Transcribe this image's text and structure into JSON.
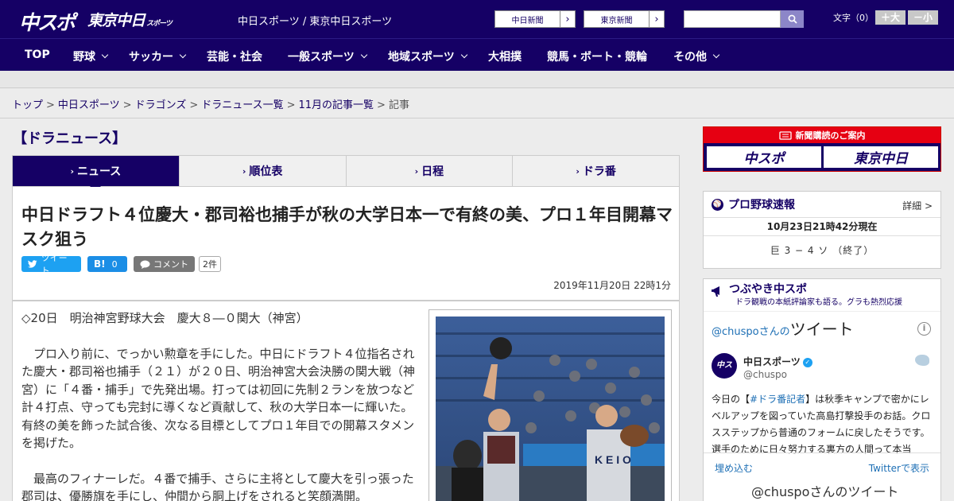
{
  "header": {
    "logo_main": "中スポ",
    "logo_tokyo": "東京中日",
    "logo_tokyo_sub": "スポーツ",
    "site_name": "中日スポーツ / 東京中日スポーツ",
    "ext_links": [
      "中日新聞",
      "東京新聞"
    ],
    "search_placeholder": "",
    "font_size_label": "文字（0）",
    "font_bigger": "＋大",
    "font_smaller": "－小"
  },
  "nav": {
    "items": [
      {
        "label": "TOP",
        "has_menu": false
      },
      {
        "label": "野球",
        "has_menu": true
      },
      {
        "label": "サッカー",
        "has_menu": true
      },
      {
        "label": "芸能・社会",
        "has_menu": false
      },
      {
        "label": "一般スポーツ",
        "has_menu": true
      },
      {
        "label": "地域スポーツ",
        "has_menu": true
      },
      {
        "label": "大相撲",
        "has_menu": false
      },
      {
        "label": "競馬・ボート・競輪",
        "has_menu": false
      },
      {
        "label": "その他",
        "has_menu": true
      }
    ]
  },
  "breadcrumb": {
    "items": [
      "トップ",
      "中日スポーツ",
      "ドラゴンズ",
      "ドラニュース一覧",
      "11月の記事一覧"
    ],
    "current": "記事"
  },
  "section_title": "【ドラニュース】",
  "tabs": [
    {
      "label": "ニュース",
      "active": true
    },
    {
      "label": "順位表",
      "active": false
    },
    {
      "label": "日程",
      "active": false
    },
    {
      "label": "ドラ番",
      "active": false
    }
  ],
  "article": {
    "title": "中日ドラフト４位慶大・郡司裕也捕手が秋の大学日本一で有終の美、プロ１年目開幕マスク狙う",
    "share": {
      "tweet_label": "ツイート",
      "hatena_label": "B!",
      "hatena_count": "0",
      "comment_label": "コメント",
      "comment_count": "2件"
    },
    "date": "2019年11月20日 22時1分",
    "paragraphs": [
      "◇20日　明治神宮野球大会　慶大８―０関大（神宮）",
      "　プロ入り前に、でっかい勲章を手にした。中日にドラフト４位指名された慶大・郡司裕也捕手（２１）が２０日、明治神宮大会決勝の関大戦（神宮）に「４番・捕手」で先発出場。打っては初回に先制２ランを放つなど計４打点、守っても完封に導くなど貢献して、秋の大学日本一に輝いた。有終の美を飾った試合後、次なる目標としてプロ１年目での開幕スタメンを掲げた。",
      "　最高のフィナーレだ。４番で捕手、さらに主将として慶大を引っ張った郡司は、優勝旗を手にし、仲間から胴上げをされると笑顔満開。"
    ]
  },
  "sidebar": {
    "subscription": {
      "head": "新聞購読のご案内",
      "btn1": "中スポ",
      "btn2": "東京中日"
    },
    "baseball": {
      "title": "プロ野球速報",
      "more": "詳細 >",
      "time": "10月23日21時42分現在",
      "score": "巨 3 − 4 ソ （終了）"
    },
    "twitter": {
      "title": "つぶやき中スポ",
      "subtitle": "ドラ観戦の本紙評論家も語る。グラも熱烈応援",
      "embed_user": "@chuspo",
      "embed_suffix": "さんの",
      "embed_title": "ツイート",
      "account_name": "中日スポーツ",
      "account_handle": "@chuspo",
      "tweet_pre": "今日の【",
      "tweet_tag": "#ドラ番記者",
      "tweet_post": "】は秋季キャンプで密かにレベルアップを図っていた高島打撃投手のお話。クロスステップから普通のフォームに戻したそうです。選手のために日々努力する裏方の人間って本当",
      "embed_link": "埋め込む",
      "view_link": "Twitterで表示",
      "next_title": "@chuspoさんのツイート"
    }
  },
  "colors": {
    "brand": "#150065",
    "accent_red": "#e60012",
    "twitter_blue": "#1da1f2"
  }
}
